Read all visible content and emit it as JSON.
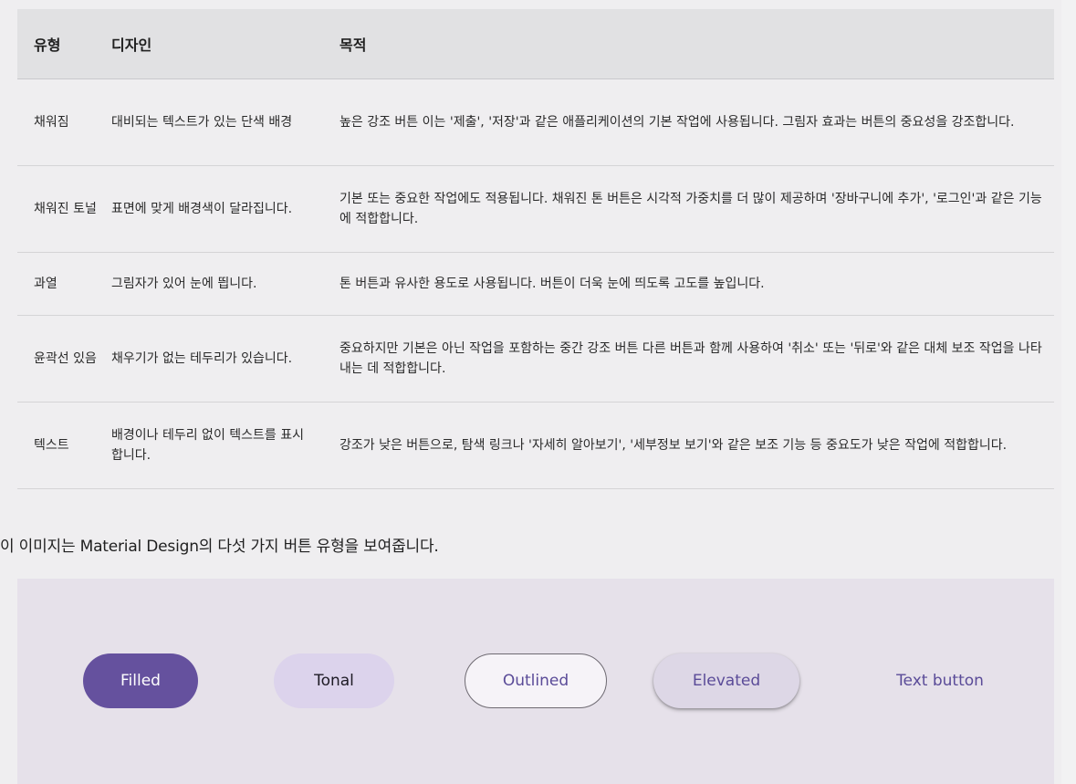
{
  "table": {
    "headers": [
      "유형",
      "디자인",
      "목적"
    ],
    "rows": [
      {
        "type": "채워짐",
        "design": "대비되는 텍스트가 있는 단색 배경",
        "purpose": "높은 강조 버튼 이는 '제출', '저장'과 같은 애플리케이션의 기본 작업에 사용됩니다. 그림자 효과는 버튼의 중요성을 강조합니다."
      },
      {
        "type": "채워진 토널",
        "design": "표면에 맞게 배경색이 달라집니다.",
        "purpose": "기본 또는 중요한 작업에도 적용됩니다. 채워진 톤 버튼은 시각적 가중치를 더 많이 제공하며 '장바구니에 추가', '로그인'과 같은 기능에 적합합니다."
      },
      {
        "type": "과열",
        "design": "그림자가 있어 눈에 띕니다.",
        "purpose": "톤 버튼과 유사한 용도로 사용됩니다. 버튼이 더욱 눈에 띄도록 고도를 높입니다."
      },
      {
        "type": "윤곽선 있음",
        "design": "채우기가 없는 테두리가 있습니다.",
        "purpose": "중요하지만 기본은 아닌 작업을 포함하는 중간 강조 버튼 다른 버튼과 함께 사용하여 '취소' 또는 '뒤로'와 같은 대체 보조 작업을 나타내는 데 적합합니다."
      },
      {
        "type": "텍스트",
        "design": "배경이나 테두리 없이 텍스트를 표시합니다.",
        "purpose": "강조가 낮은 버튼으로, 탐색 링크나 '자세히 알아보기', '세부정보 보기'와 같은 보조 기능 등 중요도가 낮은 작업에 적합합니다."
      }
    ]
  },
  "caption": "이 이미지는 Material Design의 다섯 가지 버튼 유형을 보여줍니다.",
  "demo": {
    "buttons": {
      "filled": "Filled",
      "tonal": "Tonal",
      "outlined": "Outlined",
      "elevated": "Elevated",
      "text": "Text button"
    }
  },
  "colors": {
    "primary": "#65519e",
    "tonal": "#dcd3ec",
    "demo_background": "#e6e1ea",
    "header_background": "#e1e1e3"
  }
}
